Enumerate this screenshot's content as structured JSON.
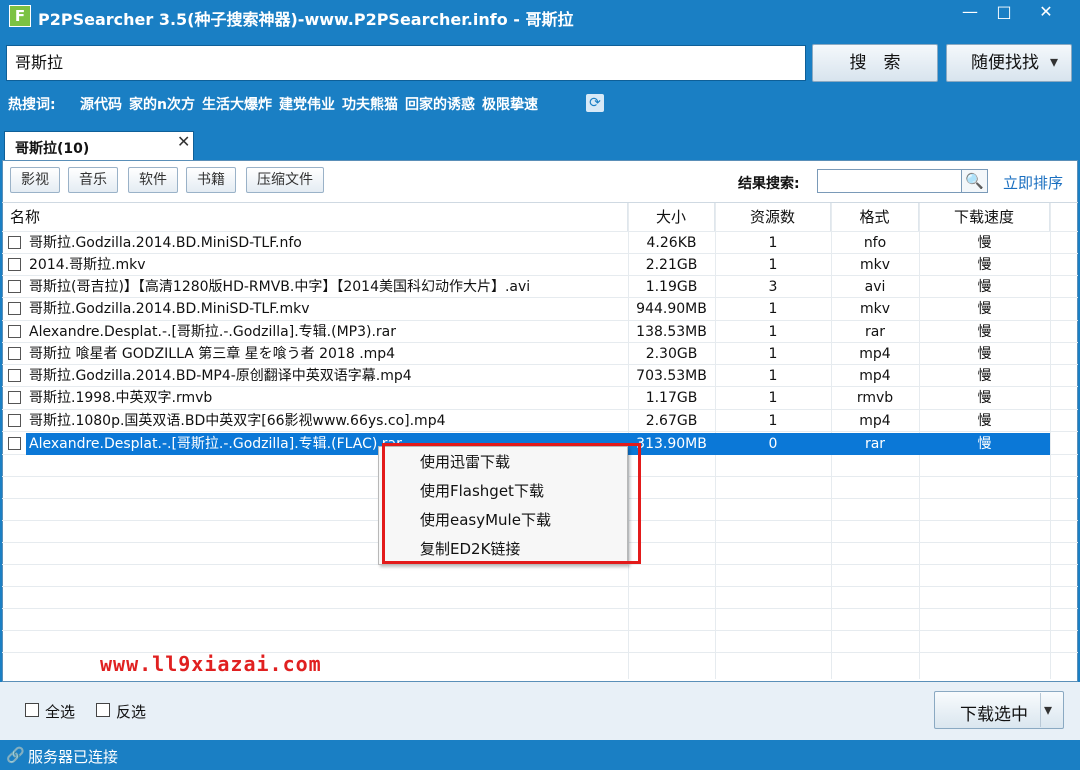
{
  "window": {
    "title": "P2PSearcher 3.5(种子搜索神器)-www.P2PSearcher.info - 哥斯拉",
    "logo_letter": "F",
    "minimize": "—",
    "maximize": "□",
    "close": "✕"
  },
  "search": {
    "value": "哥斯拉",
    "search_button": "搜　索",
    "random_button": "随便找找",
    "dropdown_arrow": "▾"
  },
  "hot": {
    "label": "热搜词:",
    "items": [
      "源代码",
      "家的n次方",
      "生活大爆炸",
      "建党伟业",
      "功夫熊猫",
      "回家的诱惑",
      "极限挚速"
    ],
    "refresh_icon": "⟳"
  },
  "tab": {
    "label": "哥斯拉(10)",
    "close": "✕"
  },
  "categories": [
    "影视",
    "音乐",
    "软件",
    "书籍",
    "压缩文件"
  ],
  "filter": {
    "label": "结果搜索:",
    "search_icon": "🔍",
    "sort_link": "立即排序"
  },
  "columns": [
    "名称",
    "大小",
    "资源数",
    "格式",
    "下载速度"
  ],
  "rows": [
    {
      "name": "哥斯拉.Godzilla.2014.BD.MiniSD-TLF.nfo",
      "size": "4.26KB",
      "count": "1",
      "format": "nfo",
      "speed": "慢"
    },
    {
      "name": "2014.哥斯拉.mkv",
      "size": "2.21GB",
      "count": "1",
      "format": "mkv",
      "speed": "慢"
    },
    {
      "name": "哥斯拉(哥吉拉)】【高清1280版HD-RMVB.中字】【2014美国科幻动作大片】.avi",
      "size": "1.19GB",
      "count": "3",
      "format": "avi",
      "speed": "慢"
    },
    {
      "name": "哥斯拉.Godzilla.2014.BD.MiniSD-TLF.mkv",
      "size": "944.90MB",
      "count": "1",
      "format": "mkv",
      "speed": "慢"
    },
    {
      "name": "Alexandre.Desplat.-.[哥斯拉.-.Godzilla].专辑.(MP3).rar",
      "size": "138.53MB",
      "count": "1",
      "format": "rar",
      "speed": "慢"
    },
    {
      "name": "哥斯拉 喰星者 GODZILLA 第三章 星を喰う者 2018 .mp4",
      "size": "2.30GB",
      "count": "1",
      "format": "mp4",
      "speed": "慢"
    },
    {
      "name": "哥斯拉.Godzilla.2014.BD-MP4-原创翻译中英双语字幕.mp4",
      "size": "703.53MB",
      "count": "1",
      "format": "mp4",
      "speed": "慢"
    },
    {
      "name": "哥斯拉.1998.中英双字.rmvb",
      "size": "1.17GB",
      "count": "1",
      "format": "rmvb",
      "speed": "慢"
    },
    {
      "name": "哥斯拉.1080p.国英双语.BD中英双字[66影视www.66ys.co].mp4",
      "size": "2.67GB",
      "count": "1",
      "format": "mp4",
      "speed": "慢"
    },
    {
      "name": "Alexandre.Desplat.-.[哥斯拉.-.Godzilla].专辑.(FLAC).rar",
      "size": "313.90MB",
      "count": "0",
      "format": "rar",
      "speed": "慢"
    }
  ],
  "context_menu": [
    "使用迅雷下载",
    "使用Flashget下载",
    "使用easyMule下载",
    "复制ED2K链接"
  ],
  "watermark": "www.ll9xiazai.com",
  "footer": {
    "select_all": "全选",
    "invert": "反选",
    "download_button": "下载选中",
    "dropdown_arrow": "▾"
  },
  "status": {
    "icon": "🔗",
    "text": "服务器已连接"
  },
  "colors": {
    "titlebar": "#1a7fc4",
    "selection": "#0b78d7",
    "highlight_border": "#e31a1a"
  }
}
